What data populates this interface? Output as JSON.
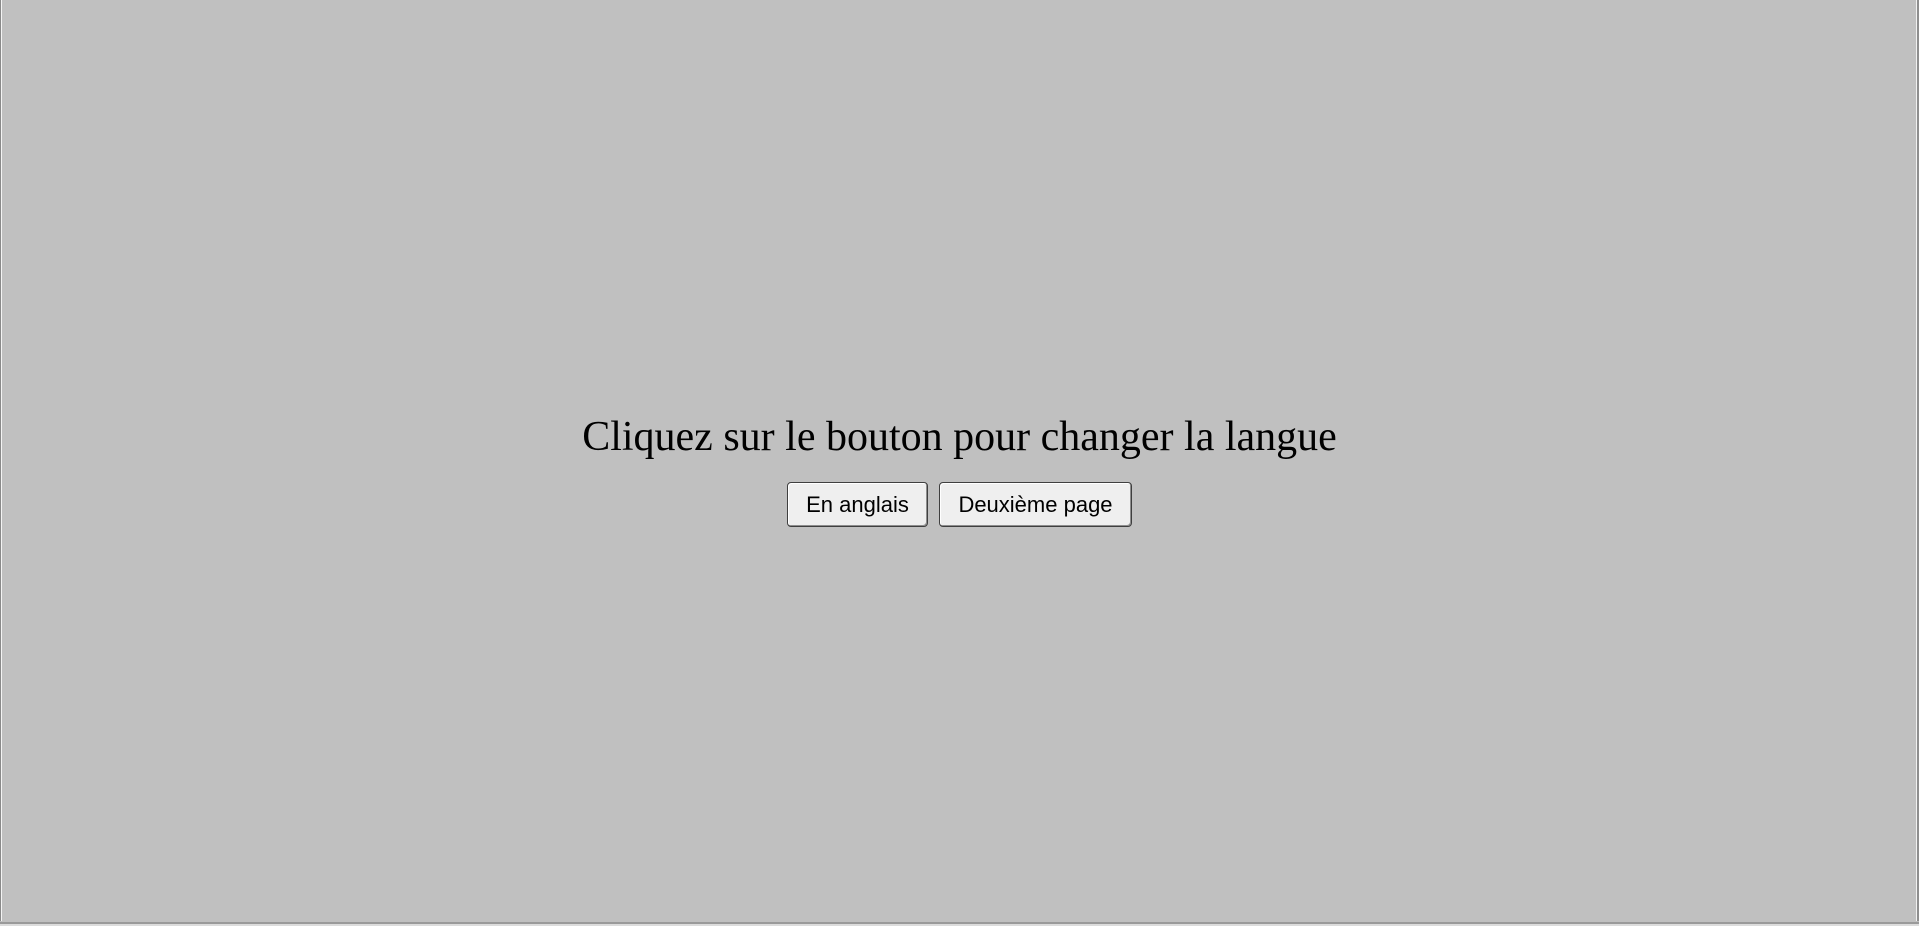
{
  "page": {
    "heading": "Cliquez sur le bouton pour changer la langue",
    "background_color": "#c0c0c0"
  },
  "buttons": {
    "english_label": "En anglais",
    "second_page_label": "Deuxième page"
  }
}
